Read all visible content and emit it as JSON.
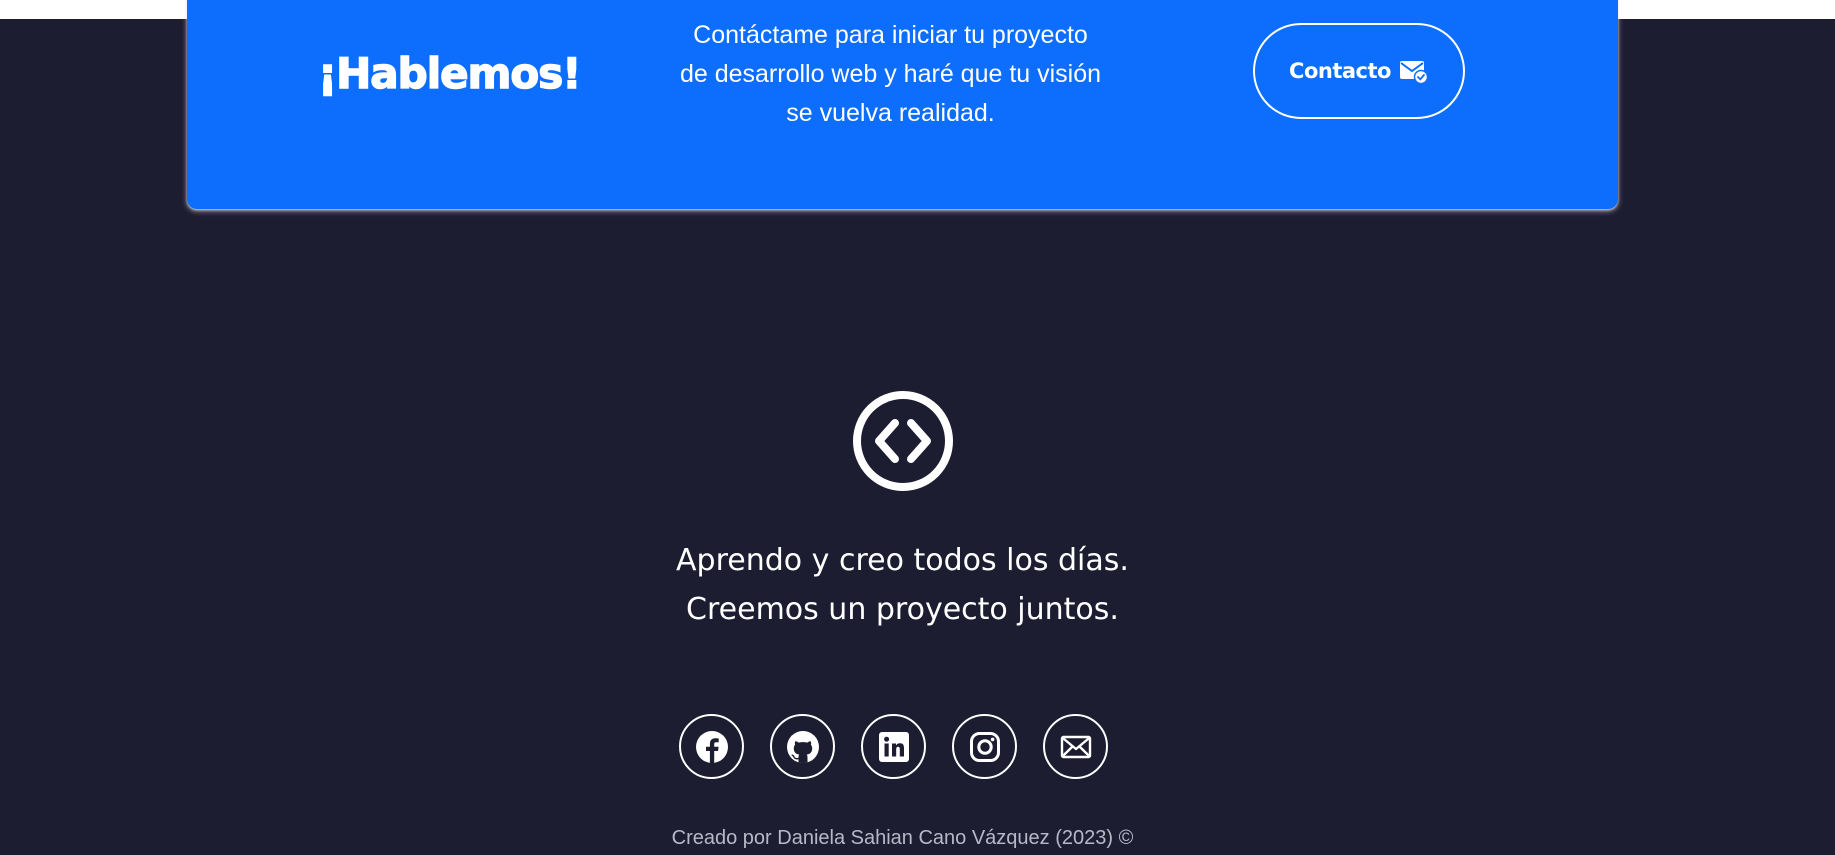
{
  "cta": {
    "title": "¡Hablemos!",
    "description": "Contáctame para iniciar tu proyecto de desarrollo web y haré que tu visión se vuelva realidad.",
    "button_label": "Contacto",
    "button_icon": "mail-check-icon"
  },
  "footer": {
    "logo_icon": "code-brackets-circle-icon",
    "tagline_line1": "Aprendo y creo todos los días.",
    "tagline_line2": "Creemos un proyecto juntos.",
    "social": [
      {
        "icon": "facebook-icon"
      },
      {
        "icon": "github-icon"
      },
      {
        "icon": "linkedin-icon"
      },
      {
        "icon": "instagram-icon"
      },
      {
        "icon": "email-icon"
      }
    ],
    "copyright": "Creado por Daniela Sahian Cano Vázquez (2023) ©"
  },
  "colors": {
    "page_background": "#1c1d31",
    "cta_background": "#0d6efd",
    "text_primary": "#ffffff",
    "text_muted": "#b8b9c7"
  }
}
